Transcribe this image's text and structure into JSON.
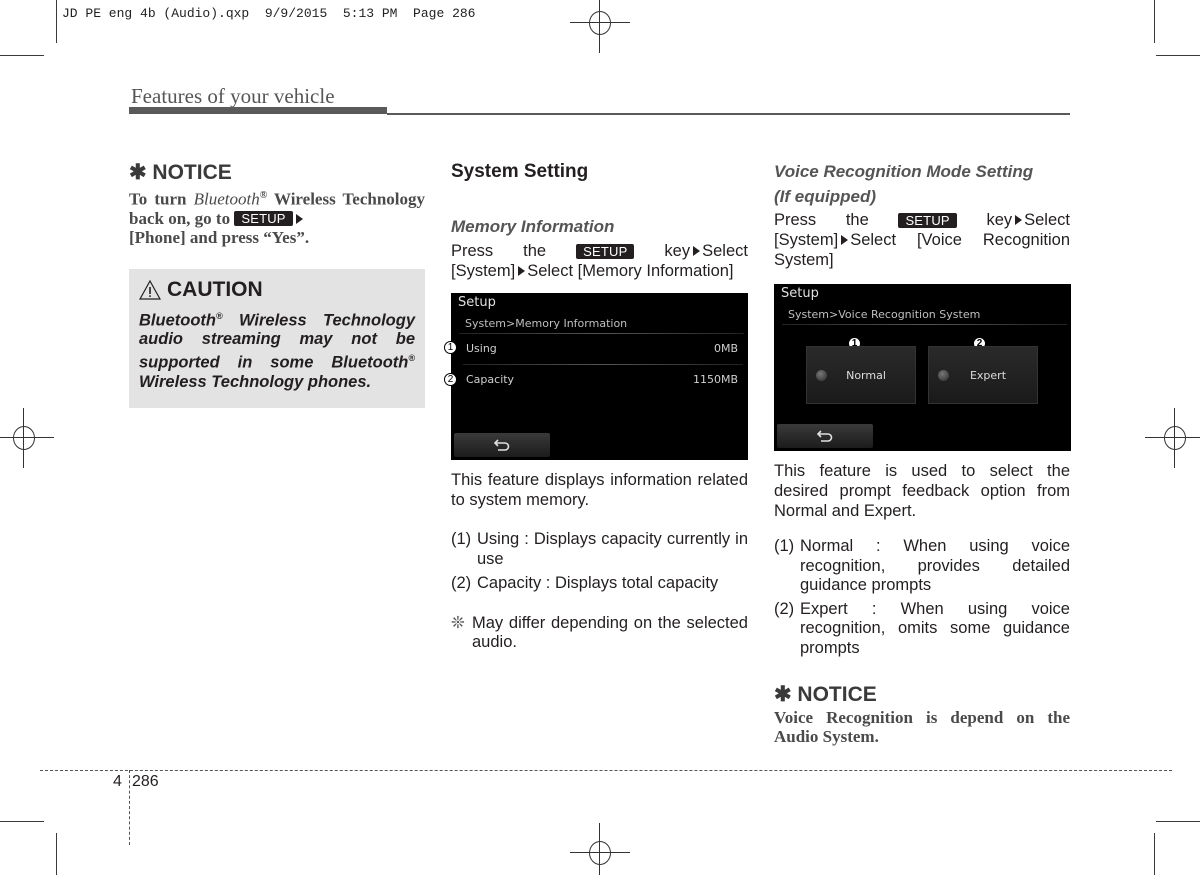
{
  "slug": "JD PE eng 4b (Audio).qxp  9/9/2015  5:13 PM  Page 286",
  "running_head": "Features of your vehicle",
  "setup_key_label": "SETUP",
  "left": {
    "notice": {
      "title": "✱ NOTICE",
      "text_1": "To turn ",
      "text_bt": "Bluetooth",
      "reg": "®",
      "text_2": " Wireless Technology back on, go to ",
      "text_3": "[Phone] and press “Yes”."
    },
    "caution": {
      "title": "CAUTION",
      "line_1a": "Bluetooth",
      "reg": "®",
      "line_1b": " Wireless Technology audio streaming may not be supported in some Bluetooth",
      "line_1c": " Wireless Technology phones."
    }
  },
  "middle": {
    "heading": "System Setting",
    "subheading": "Memory Information",
    "press_1": "Press",
    "press_2": "the",
    "press_3": "key",
    "press_4": "Select",
    "press_line2a": "[System]",
    "press_line2b": "Select [Memory Information]",
    "screen": {
      "title": "Setup",
      "breadcrumb": "System>Memory Information",
      "rows": [
        {
          "callout": "1",
          "label": "Using",
          "value": "0MB"
        },
        {
          "callout": "2",
          "label": "Capacity",
          "value": "1150MB"
        }
      ],
      "back_icon": "back-arrow-icon"
    },
    "description": "This feature displays information related to system memory.",
    "list": [
      {
        "num": "(1)",
        "text": "Using : Displays capacity currently in use"
      },
      {
        "num": "(2)",
        "text": "Capacity : Displays total capacity"
      }
    ],
    "note_symbol": "❊",
    "note": "May differ depending on the selected audio."
  },
  "right": {
    "heading_1": "Voice Recognition Mode Setting",
    "heading_2": "(If equipped)",
    "press_1": "Press",
    "press_2": "the",
    "press_3": "key",
    "press_4": "Select",
    "press_line2a": "[System]",
    "press_line2b": "Select [Voice Recognition System]",
    "screen": {
      "title": "Setup",
      "breadcrumb": "System>Voice Recognition System",
      "options": [
        {
          "callout": "1",
          "label": "Normal"
        },
        {
          "callout": "2",
          "label": "Expert"
        }
      ],
      "back_icon": "back-arrow-icon"
    },
    "description": "This feature is used to select the desired prompt feedback option from Normal and Expert.",
    "list": [
      {
        "num": "(1)",
        "text": "Normal : When using voice recognition, provides detailed guidance prompts"
      },
      {
        "num": "(2)",
        "text": "Expert : When using voice recognition, omits some guidance prompts"
      }
    ],
    "notice": {
      "title": "✱ NOTICE",
      "text": "Voice Recognition is depend on the Audio System."
    }
  },
  "footer": {
    "chapter": "4",
    "page": "286"
  }
}
